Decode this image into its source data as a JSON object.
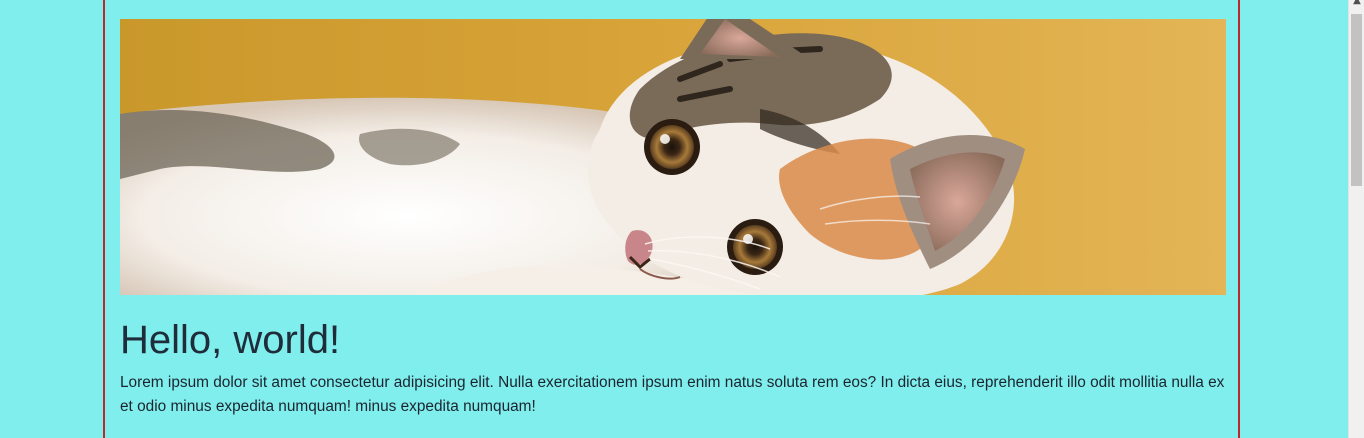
{
  "page": {
    "heading": "Hello, world!",
    "body": "Lorem ipsum dolor sit amet consectetur adipisicing elit. Nulla exercitationem ipsum enim natus soluta rem eos? In dicta eius, reprehenderit illo odit mollitia nulla ex et odio minus expedita numquam! minus expedita numquam!"
  },
  "hero_image": {
    "alt": "Kitten lying on its side looking at the camera"
  },
  "scrollbar": {
    "arrow_icon": "▲"
  },
  "colors": {
    "page_background": "#80eeec",
    "container_border": "#c0272d",
    "heading_text": "#1f2d3a",
    "body_text": "#1a2530"
  }
}
